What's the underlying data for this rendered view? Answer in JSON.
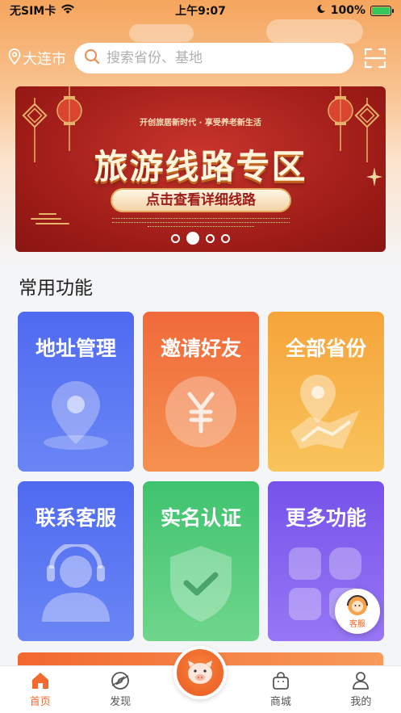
{
  "status_bar": {
    "carrier": "无SIM卡",
    "time": "上午9:07",
    "battery": "100%",
    "battery_level": 1.0
  },
  "header": {
    "city": "大连市",
    "search_placeholder": "搜索省份、基地",
    "scan_icon": "scan-icon"
  },
  "banner": {
    "subtitle": "开创旅居新时代 · 享受养老新生活",
    "title": "旅游线路专区",
    "button": "点击查看详细线路",
    "page_count": 4,
    "active_page": 2
  },
  "section": {
    "title": "常用功能"
  },
  "tiles": [
    {
      "label": "地址管理",
      "icon": "location-pin-icon",
      "color": "#5a75f2"
    },
    {
      "label": "邀请好友",
      "icon": "yen-coin-icon",
      "color": "#f27a44"
    },
    {
      "label": "全部省份",
      "icon": "map-pin-icon",
      "color": "#f7b44a"
    },
    {
      "label": "联系客服",
      "icon": "headset-user-icon",
      "color": "#5a75f2"
    },
    {
      "label": "实名认证",
      "icon": "shield-check-icon",
      "color": "#4fcb7b"
    },
    {
      "label": "更多功能",
      "icon": "grid-apps-icon",
      "color": "#8463ef"
    }
  ],
  "floating_service": {
    "label": "客服"
  },
  "tabbar": {
    "items": [
      {
        "label": "首页",
        "icon": "home-icon",
        "active": true
      },
      {
        "label": "发现",
        "icon": "compass-icon",
        "active": false
      },
      {
        "label": "",
        "icon": "pig-mascot-icon",
        "active": false
      },
      {
        "label": "商城",
        "icon": "shopping-bag-icon",
        "active": false
      },
      {
        "label": "我的",
        "icon": "user-icon",
        "active": false
      }
    ]
  },
  "colors": {
    "accent": "#f26a2e",
    "header_gradient_top": "#f5a55d",
    "banner_red": "#9d1b17"
  }
}
